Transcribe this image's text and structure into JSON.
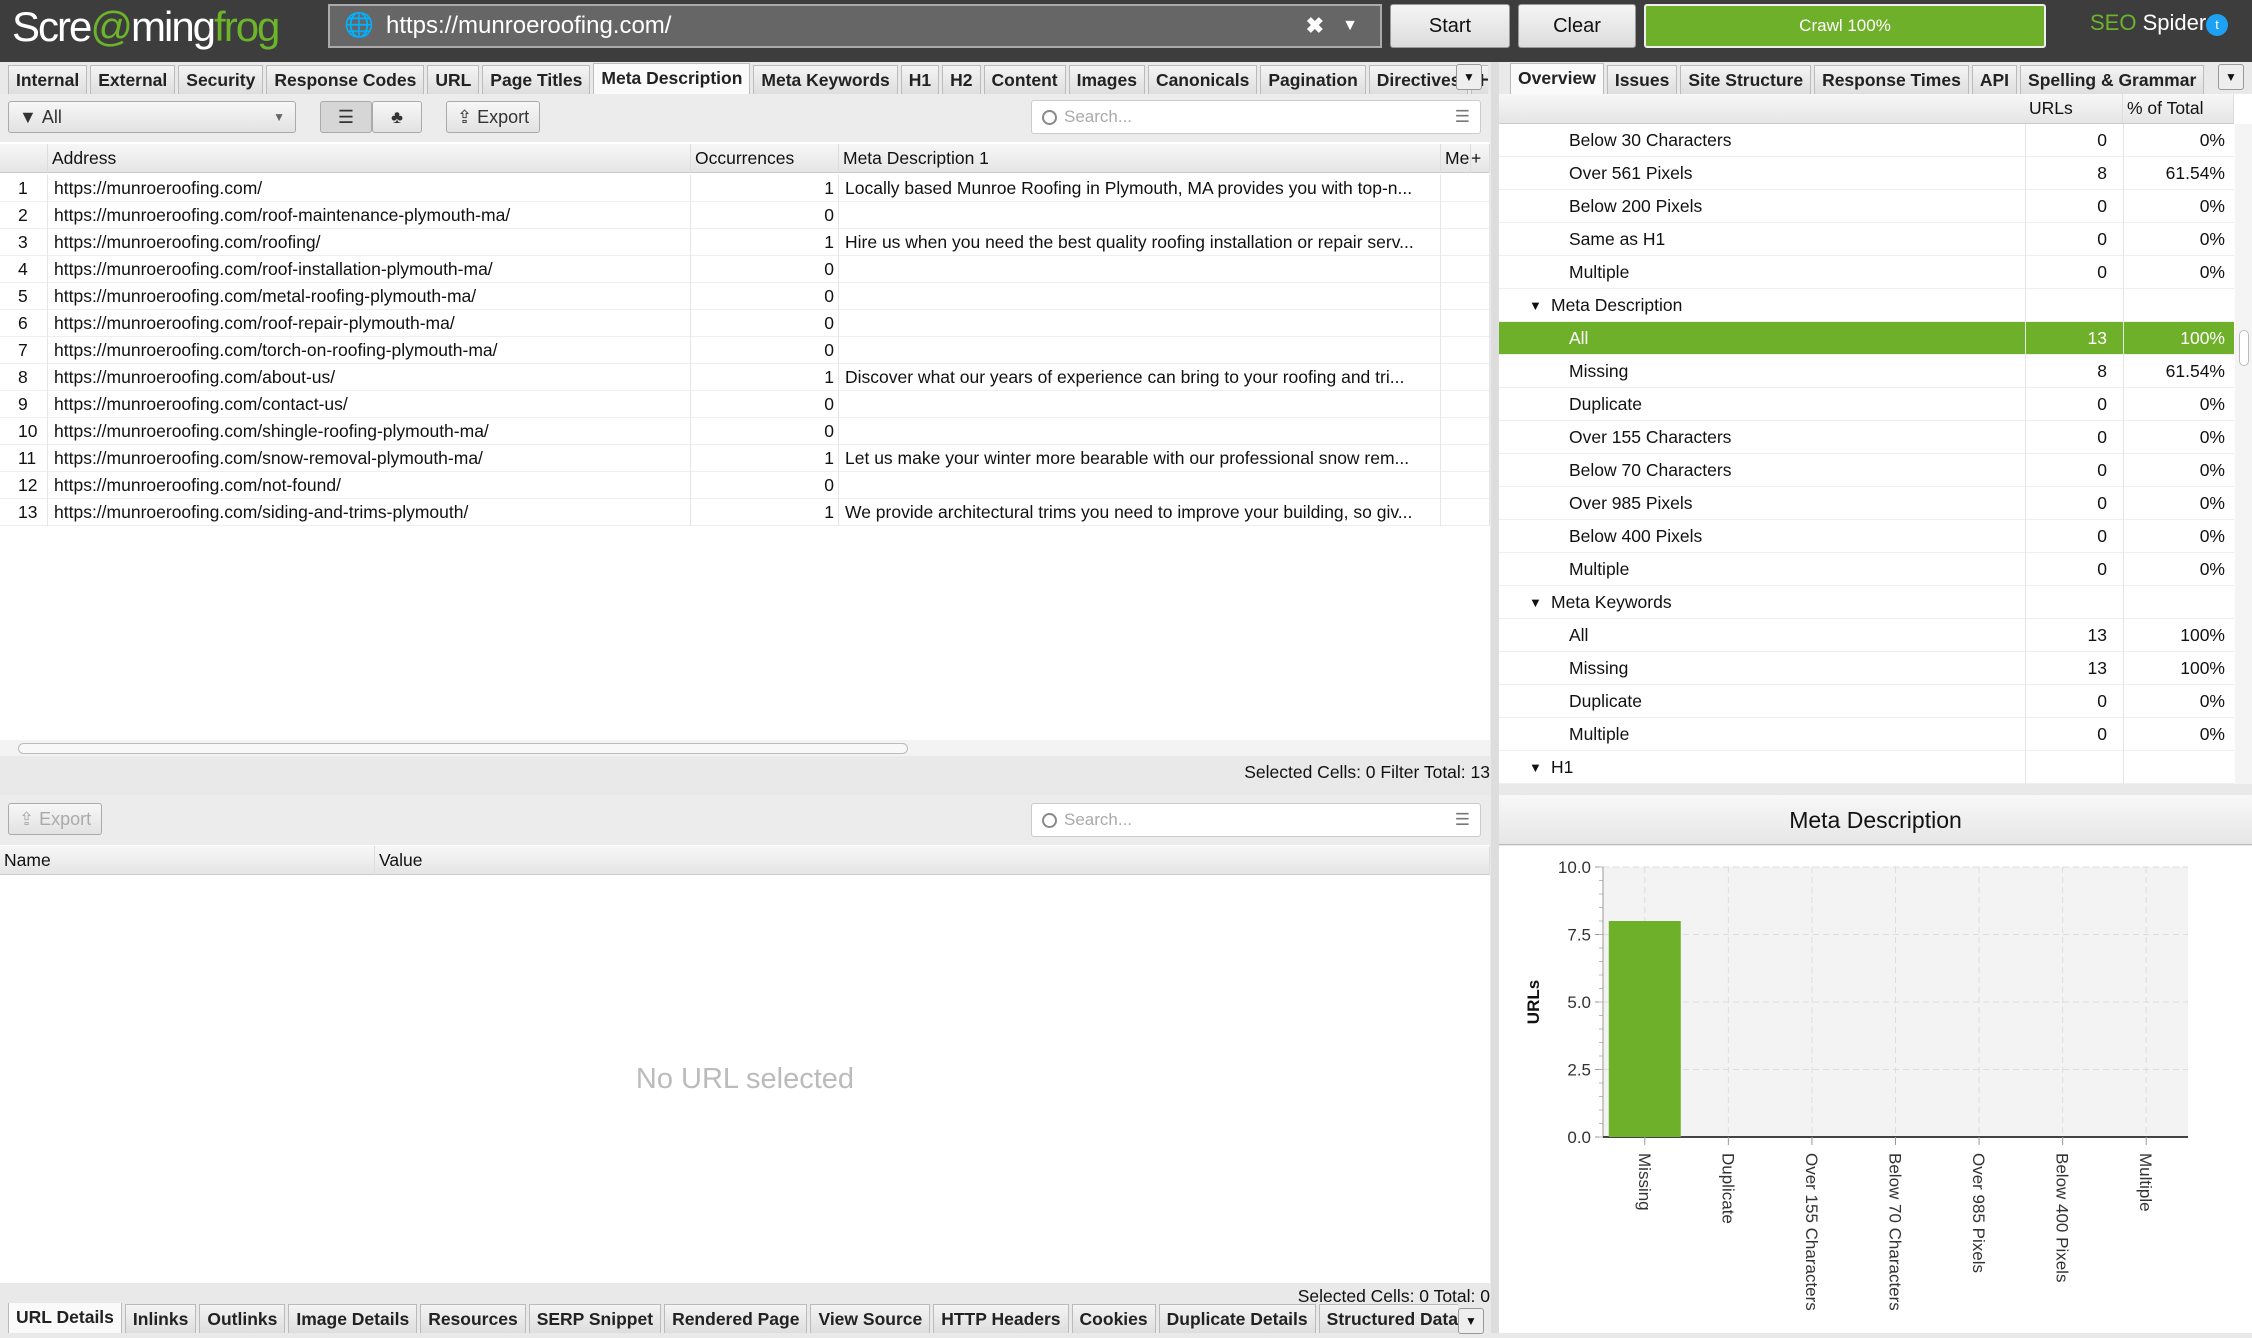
{
  "app": {
    "logo_text": "Screamingfrog",
    "brand": "SEO",
    "brand2": "Spider"
  },
  "urlbar": {
    "value": "https://munroeroofing.com/"
  },
  "buttons": {
    "start": "Start",
    "clear": "Clear",
    "crawl": "Crawl 100%"
  },
  "main_tabs": [
    "Internal",
    "External",
    "Security",
    "Response Codes",
    "URL",
    "Page Titles",
    "Meta Description",
    "Meta Keywords",
    "H1",
    "H2",
    "Content",
    "Images",
    "Canonicals",
    "Pagination",
    "Directives",
    "H"
  ],
  "main_active_tab": "Meta Description",
  "toolbar": {
    "filter": "All",
    "export": "Export",
    "search_placeholder": "Search..."
  },
  "table": {
    "columns": [
      "Address",
      "Occurrences",
      "Meta Description 1",
      "Me"
    ],
    "rows": [
      {
        "n": "1",
        "address": "https://munroeroofing.com/",
        "occ": "1",
        "desc": "Locally based Munroe Roofing in Plymouth, MA provides you with top-n..."
      },
      {
        "n": "2",
        "address": "https://munroeroofing.com/roof-maintenance-plymouth-ma/",
        "occ": "0",
        "desc": ""
      },
      {
        "n": "3",
        "address": "https://munroeroofing.com/roofing/",
        "occ": "1",
        "desc": "Hire us when you need the best quality roofing installation or repair serv..."
      },
      {
        "n": "4",
        "address": "https://munroeroofing.com/roof-installation-plymouth-ma/",
        "occ": "0",
        "desc": ""
      },
      {
        "n": "5",
        "address": "https://munroeroofing.com/metal-roofing-plymouth-ma/",
        "occ": "0",
        "desc": ""
      },
      {
        "n": "6",
        "address": "https://munroeroofing.com/roof-repair-plymouth-ma/",
        "occ": "0",
        "desc": ""
      },
      {
        "n": "7",
        "address": "https://munroeroofing.com/torch-on-roofing-plymouth-ma/",
        "occ": "0",
        "desc": ""
      },
      {
        "n": "8",
        "address": "https://munroeroofing.com/about-us/",
        "occ": "1",
        "desc": "Discover what our years of experience can bring to your roofing and tri..."
      },
      {
        "n": "9",
        "address": "https://munroeroofing.com/contact-us/",
        "occ": "0",
        "desc": ""
      },
      {
        "n": "10",
        "address": "https://munroeroofing.com/shingle-roofing-plymouth-ma/",
        "occ": "0",
        "desc": ""
      },
      {
        "n": "11",
        "address": "https://munroeroofing.com/snow-removal-plymouth-ma/",
        "occ": "1",
        "desc": "Let us make your winter more bearable with our professional snow rem..."
      },
      {
        "n": "12",
        "address": "https://munroeroofing.com/not-found/",
        "occ": "0",
        "desc": ""
      },
      {
        "n": "13",
        "address": "https://munroeroofing.com/siding-and-trims-plymouth/",
        "occ": "1",
        "desc": "We provide architectural trims you need to improve your building, so giv..."
      }
    ],
    "status": "Selected Cells:  0  Filter Total:  13"
  },
  "lower": {
    "export": "Export",
    "search_placeholder": "Search...",
    "columns": [
      "Name",
      "Value"
    ],
    "empty": "No URL selected",
    "status": "Selected Cells:  0  Total:  0",
    "tabs": [
      "URL Details",
      "Inlinks",
      "Outlinks",
      "Image Details",
      "Resources",
      "SERP Snippet",
      "Rendered Page",
      "View Source",
      "HTTP Headers",
      "Cookies",
      "Duplicate Details",
      "Structured Data Deta"
    ],
    "active_tab": "URL Details"
  },
  "right_tabs": [
    "Overview",
    "Issues",
    "Site Structure",
    "Response Times",
    "API",
    "Spelling & Grammar"
  ],
  "right_active_tab": "Overview",
  "overview": {
    "columns": [
      "URLs",
      "% of Total"
    ],
    "rows": [
      {
        "label": "Below 30 Characters",
        "urls": "0",
        "pct": "0%",
        "type": "item"
      },
      {
        "label": "Over 561 Pixels",
        "urls": "8",
        "pct": "61.54%",
        "type": "item"
      },
      {
        "label": "Below 200 Pixels",
        "urls": "0",
        "pct": "0%",
        "type": "item"
      },
      {
        "label": "Same as H1",
        "urls": "0",
        "pct": "0%",
        "type": "item"
      },
      {
        "label": "Multiple",
        "urls": "0",
        "pct": "0%",
        "type": "item"
      },
      {
        "label": "Meta Description",
        "urls": "",
        "pct": "",
        "type": "section"
      },
      {
        "label": "All",
        "urls": "13",
        "pct": "100%",
        "type": "selected"
      },
      {
        "label": "Missing",
        "urls": "8",
        "pct": "61.54%",
        "type": "item"
      },
      {
        "label": "Duplicate",
        "urls": "0",
        "pct": "0%",
        "type": "item"
      },
      {
        "label": "Over 155 Characters",
        "urls": "0",
        "pct": "0%",
        "type": "item"
      },
      {
        "label": "Below 70 Characters",
        "urls": "0",
        "pct": "0%",
        "type": "item"
      },
      {
        "label": "Over 985 Pixels",
        "urls": "0",
        "pct": "0%",
        "type": "item"
      },
      {
        "label": "Below 400 Pixels",
        "urls": "0",
        "pct": "0%",
        "type": "item"
      },
      {
        "label": "Multiple",
        "urls": "0",
        "pct": "0%",
        "type": "item"
      },
      {
        "label": "Meta Keywords",
        "urls": "",
        "pct": "",
        "type": "section"
      },
      {
        "label": "All",
        "urls": "13",
        "pct": "100%",
        "type": "item"
      },
      {
        "label": "Missing",
        "urls": "13",
        "pct": "100%",
        "type": "item"
      },
      {
        "label": "Duplicate",
        "urls": "0",
        "pct": "0%",
        "type": "item"
      },
      {
        "label": "Multiple",
        "urls": "0",
        "pct": "0%",
        "type": "item"
      },
      {
        "label": "H1",
        "urls": "",
        "pct": "",
        "type": "section"
      }
    ]
  },
  "colors": {
    "accent": "#6fb02a",
    "topbar": "#3d3d3d"
  },
  "chart_data": {
    "type": "bar",
    "title": "Meta Description",
    "ylabel": "URLs",
    "xlabel": "",
    "categories": [
      "Missing",
      "Duplicate",
      "Over 155 Characters",
      "Below 70 Characters",
      "Over 985 Pixels",
      "Below 400 Pixels",
      "Multiple"
    ],
    "values": [
      8,
      0,
      0,
      0,
      0,
      0,
      0
    ],
    "ylim": [
      0,
      10
    ],
    "yticks": [
      "0.0",
      "2.5",
      "5.0",
      "7.5",
      "10.0"
    ],
    "grid": true,
    "bar_color": "#6fb02a"
  }
}
